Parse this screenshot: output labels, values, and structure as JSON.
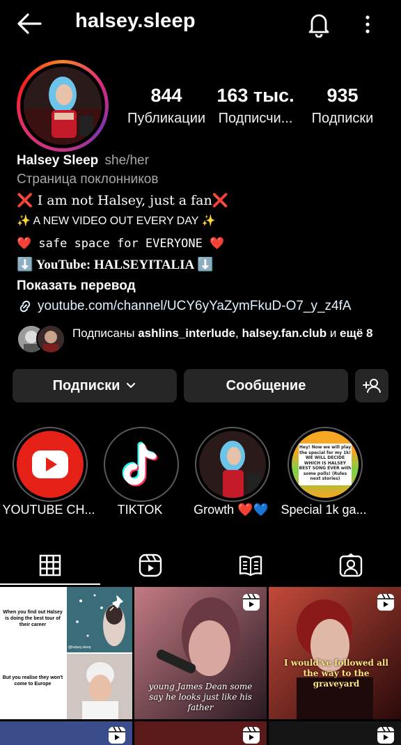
{
  "header": {
    "title": "halsey.sleep"
  },
  "profile": {
    "stats": [
      {
        "value": "844",
        "label": "Публикации"
      },
      {
        "value": "163 тыс.",
        "label": "Подписчи..."
      },
      {
        "value": "935",
        "label": "Подписки"
      }
    ],
    "name": "Halsey Sleep",
    "pronouns": "she/her",
    "category": "Страница поклонников",
    "bio_lines": [
      "❌ I am not Halsey, just a fan❌",
      "✨ A NEW VIDEO OUT EVERY DAY ✨",
      "❤️ safe space for EVERYONE ❤️",
      "⬇️ YouTube: HALSEYITALIA ⬇️"
    ],
    "translate": "Показать перевод",
    "link": "youtube.com/channel/UCY6yYaZymFkuD-O7_y_z4fA",
    "followed_by": {
      "prefix": "Подписаны",
      "user1": "ashlins_interlude",
      "sep": ",",
      "user2": "halsey.fan.club",
      "and": "и",
      "more": "ещё",
      "count": "8"
    }
  },
  "actions": {
    "following": "Подписки",
    "message": "Сообщение"
  },
  "highlights": [
    {
      "label": "YOUTUBE CH..."
    },
    {
      "label": "TIKTOK"
    },
    {
      "label": "Growth ❤️💙"
    },
    {
      "label": "Special 1k ga..."
    }
  ],
  "highlight4_text": "Hey! Now we will play the special for my 1k! WE WILL DECIDE WHICH IS HALSEY BEST SONG EVER with some polls! (Rules next stories)",
  "grid": {
    "post1_top": "When you find out Halsey is doing the best tour of their career",
    "post1_bottom": "But you realise they won't come to Europe",
    "post1_tag": "@halsey.sleep",
    "post2_caption": "young James Dean some say he looks just like his father",
    "post3_caption": "I would've followed all the way to the graveyard"
  },
  "colors": {
    "background": "#000000",
    "button": "#262626",
    "muted": "#a8a8a8",
    "link": "#e0f1ff"
  }
}
